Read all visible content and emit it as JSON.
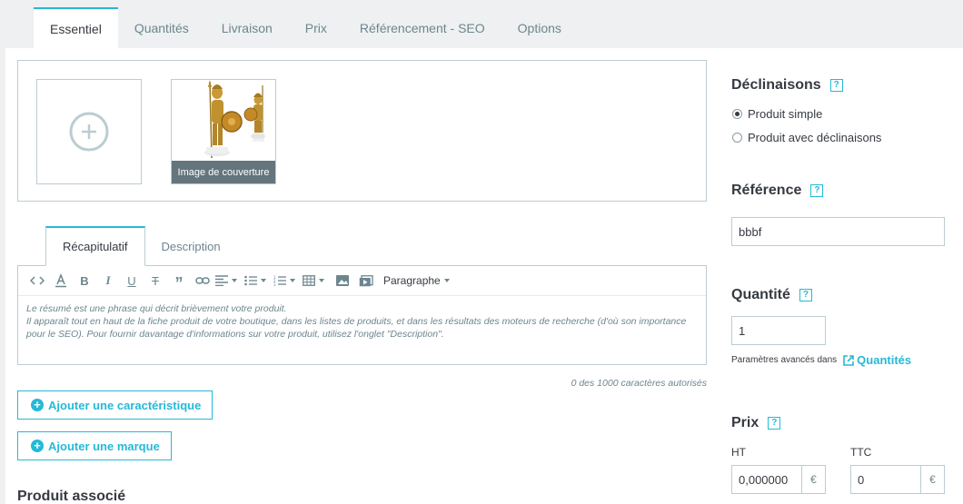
{
  "tabs": [
    "Essentiel",
    "Quantités",
    "Livraison",
    "Prix",
    "Référencement - SEO",
    "Options"
  ],
  "images": {
    "cover_label": "Image de couverture"
  },
  "editor": {
    "tabs": [
      "Récapitulatif",
      "Description"
    ],
    "paragraph_label": "Paragraphe",
    "placeholder_line1": "Le résumé est une phrase qui décrit brièvement votre produit.",
    "placeholder_line2": "Il apparaît tout en haut de la fiche produit de votre boutique, dans les listes de produits, et dans les résultats des moteurs de recherche (d'où son importance pour le SEO). Pour fournir davantage d'informations sur votre produit, utilisez l'onglet \"Description\".",
    "counter": "0 des 1000 caractères autorisés"
  },
  "buttons": {
    "add_feature": "Ajouter une caractéristique",
    "add_brand": "Ajouter une marque"
  },
  "associated_product_title": "Produit associé",
  "sidebar": {
    "combinations_title": "Déclinaisons",
    "help_mark": "?",
    "option_simple": "Produit simple",
    "option_combinations": "Produit avec déclinaisons",
    "reference_title": "Référence",
    "reference_value": "bbbf",
    "quantity_title": "Quantité",
    "quantity_value": "1",
    "advanced_note": "Paramètres avancés dans",
    "quantities_link": "Quantités",
    "price_title": "Prix",
    "ht_label": "HT",
    "ttc_label": "TTC",
    "ht_value": "0,000000",
    "ttc_value": "0",
    "currency": "€"
  },
  "colors": {
    "accent": "#25b9d7",
    "border": "#bbcdd2",
    "text": "#363a41",
    "muted": "#6c868e"
  }
}
